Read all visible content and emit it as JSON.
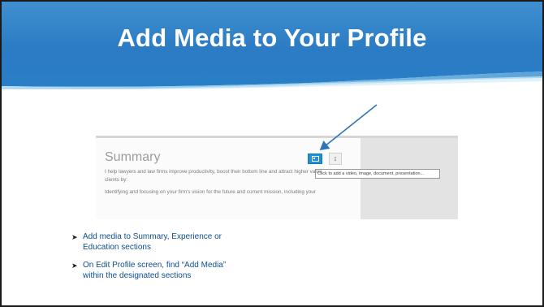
{
  "slide": {
    "title": "Add Media to Your Profile"
  },
  "screenshot": {
    "section_heading": "Summary",
    "tooltip": "Click to add a video, image, document, presentation...",
    "summary_lines": [
      "I help lawyers and law firms improve productivity, boost their bottom line and attract higher value",
      "clients by:",
      "Identifying and focusing on your firm's vision for the future and current mission, including your"
    ],
    "add_media_icon": "add-media-icon",
    "reorder_icon": "reorder-icon"
  },
  "bullets": [
    {
      "line1": "Add media to Summary, Experience or",
      "line2": "Education sections"
    },
    {
      "line1": "On Edit Profile screen, find “Add Media”",
      "line2": "within the designated sections"
    }
  ],
  "colors": {
    "banner_top": "#4a9ad6",
    "banner_bottom": "#1d6db5",
    "bullet_text": "#0d4f8c",
    "arrow": "#2e75b6",
    "button": "#1f8fd6"
  }
}
